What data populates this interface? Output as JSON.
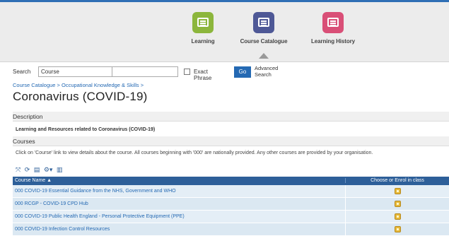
{
  "nav": {
    "items": [
      {
        "label": "Learning",
        "color": "#8cb63c",
        "icon": "learning-screen-icon"
      },
      {
        "label": "Course Catalogue",
        "color": "#4e5896",
        "icon": "catalogue-screen-icon"
      },
      {
        "label": "Learning History",
        "color": "#d94f77",
        "icon": "history-screen-icon"
      }
    ],
    "active": "Course Catalogue"
  },
  "search": {
    "label": "Search",
    "scope_value": "Course",
    "query_value": "",
    "exact_phrase_label": "Exact Phrase",
    "exact_phrase_checked": false,
    "go_label": "Go",
    "advanced_label": "Advanced Search"
  },
  "breadcrumb": "Course Catalogue > Occupational Knowledge & Skills >",
  "page_title": "Coronavirus (COVID-19)",
  "description": {
    "heading": "Description",
    "text": "Learning and Resources related to Coronavirus (COVID-19)"
  },
  "courses": {
    "heading": "Courses",
    "hint": "Click on 'Course' link to view details about the course. All courses beginning with '000' are nationally provided. Any other courses are provided by your organisation.",
    "columns": {
      "name": "Course Name",
      "sort_indicator": "▲",
      "enrol": "Choose or Enrol in class"
    },
    "rows": [
      {
        "name": "000 COVID-19 Essential Guidance from the NHS, Government and WHO"
      },
      {
        "name": "000 RCGP - COVID-19 CPD Hub"
      },
      {
        "name": "000 COVID-19 Public Health England - Personal Protective Equipment (PPE)"
      },
      {
        "name": "000 COVID-19 Infection Control Resources"
      }
    ]
  },
  "colors": {
    "accent": "#2469b3",
    "header": "#2d5f99"
  }
}
